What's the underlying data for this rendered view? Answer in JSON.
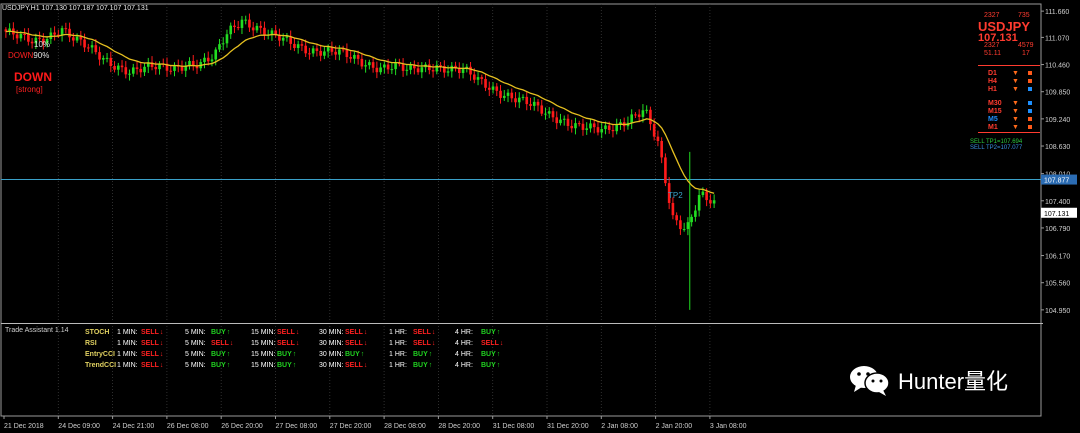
{
  "header": {
    "symbol_info": "USDJPY,H1  107.130 107.187 107.107 107.131"
  },
  "left_info": {
    "pct1": "10%",
    "pct2": "90%",
    "pct2_prefix": "DOWN",
    "direction": "DOWN",
    "strength": "[strong]"
  },
  "right_block": {
    "nums_top_left": "2327",
    "nums_top_right": "735",
    "pair": "USDJPY",
    "tf_price": "107.131",
    "nums_mid_left": "2327",
    "nums_mid_right": "4579",
    "nums_low_left": "51.11",
    "nums_low_right": "17",
    "timeframes": [
      {
        "label": "D1",
        "arrow": "▼",
        "color": "#ff3b2f",
        "box": "#ff5a1a"
      },
      {
        "label": "H4",
        "arrow": "▼",
        "color": "#ff3b2f",
        "box": "#ff5a1a"
      },
      {
        "label": "H1",
        "arrow": "▼",
        "color": "#ff3b2f",
        "box": "#1e90ff"
      },
      {
        "label": "M30",
        "arrow": "▼",
        "color": "#ff3b2f",
        "box": "#1e90ff"
      },
      {
        "label": "M15",
        "arrow": "▼",
        "color": "#ff3b2f",
        "box": "#1e90ff"
      },
      {
        "label": "M5",
        "arrow": "▼",
        "color": "#1e90ff",
        "box": "#ff5a1a"
      },
      {
        "label": "M1",
        "arrow": "▼",
        "color": "#ff3b2f",
        "box": "#ff5a1a"
      }
    ],
    "sell_tp1": "SELL TP1=107.694",
    "sell_tp2": "SELL TP2=107.077"
  },
  "tp_label": "TP2",
  "chart_data": {
    "type": "candlestick",
    "symbol": "USDJPY",
    "timeframe": "H1",
    "y_ticks": [
      "111.660",
      "111.070",
      "110.460",
      "109.850",
      "109.240",
      "108.630",
      "108.010",
      "107.400",
      "106.790",
      "106.170",
      "105.560",
      "104.950"
    ],
    "ylim": [
      104.7,
      111.82
    ],
    "x_ticks": [
      "21 Dec 2018",
      "24 Dec 09:00",
      "24 Dec 21:00",
      "26 Dec 08:00",
      "26 Dec 20:00",
      "27 Dec 08:00",
      "27 Dec 20:00",
      "28 Dec 08:00",
      "28 Dec 20:00",
      "31 Dec 08:00",
      "31 Dec 20:00",
      "2 Jan 08:00",
      "2 Jan 20:00",
      "3 Jan 08:00"
    ],
    "price_labels": {
      "level_line": "107.877",
      "current": "107.131"
    },
    "level_line_price": 107.877,
    "current_price": 107.131,
    "close_path": [
      111.2,
      111.05,
      110.95,
      111.1,
      111.3,
      111.0,
      110.8,
      110.6,
      110.45,
      110.3,
      110.35,
      110.4,
      110.4,
      110.5,
      110.45,
      110.6,
      111.2,
      111.5,
      111.3,
      111.1,
      111.0,
      110.9,
      110.8,
      110.75,
      110.7,
      110.6,
      110.5,
      110.4,
      110.4,
      110.3,
      110.4,
      110.45,
      110.35,
      110.3,
      110.1,
      109.95,
      109.8,
      109.65,
      109.5,
      109.35,
      109.25,
      109.1,
      109.0,
      108.95,
      109.1,
      109.3,
      109.45,
      108.6,
      107.0,
      106.8,
      107.6,
      107.3
    ]
  },
  "panel": {
    "title": "Trade Assistant 1.14",
    "tf_labels": [
      "1 MIN:",
      "5 MIN:",
      "15 MIN:",
      "30 MIN:",
      "1 HR:",
      "4 HR:"
    ],
    "rows": [
      {
        "name": "STOCH",
        "signals": [
          "SELL",
          "BUY",
          "SELL",
          "SELL",
          "SELL",
          "BUY"
        ]
      },
      {
        "name": "RSI",
        "signals": [
          "SELL",
          "SELL",
          "SELL",
          "SELL",
          "SELL",
          "SELL"
        ]
      },
      {
        "name": "EntryCCI",
        "signals": [
          "SELL",
          "BUY",
          "BUY",
          "BUY",
          "BUY",
          "BUY"
        ]
      },
      {
        "name": "TrendCCI",
        "signals": [
          "SELL",
          "BUY",
          "BUY",
          "SELL",
          "BUY",
          "BUY"
        ]
      }
    ]
  },
  "watermark": {
    "text": "Hunter量化"
  },
  "colors": {
    "bull": "#22dd22",
    "bear": "#ff1a1a",
    "ma": "#e6c020",
    "grid": "#2a3a4a",
    "level": "#3aa0c8"
  }
}
